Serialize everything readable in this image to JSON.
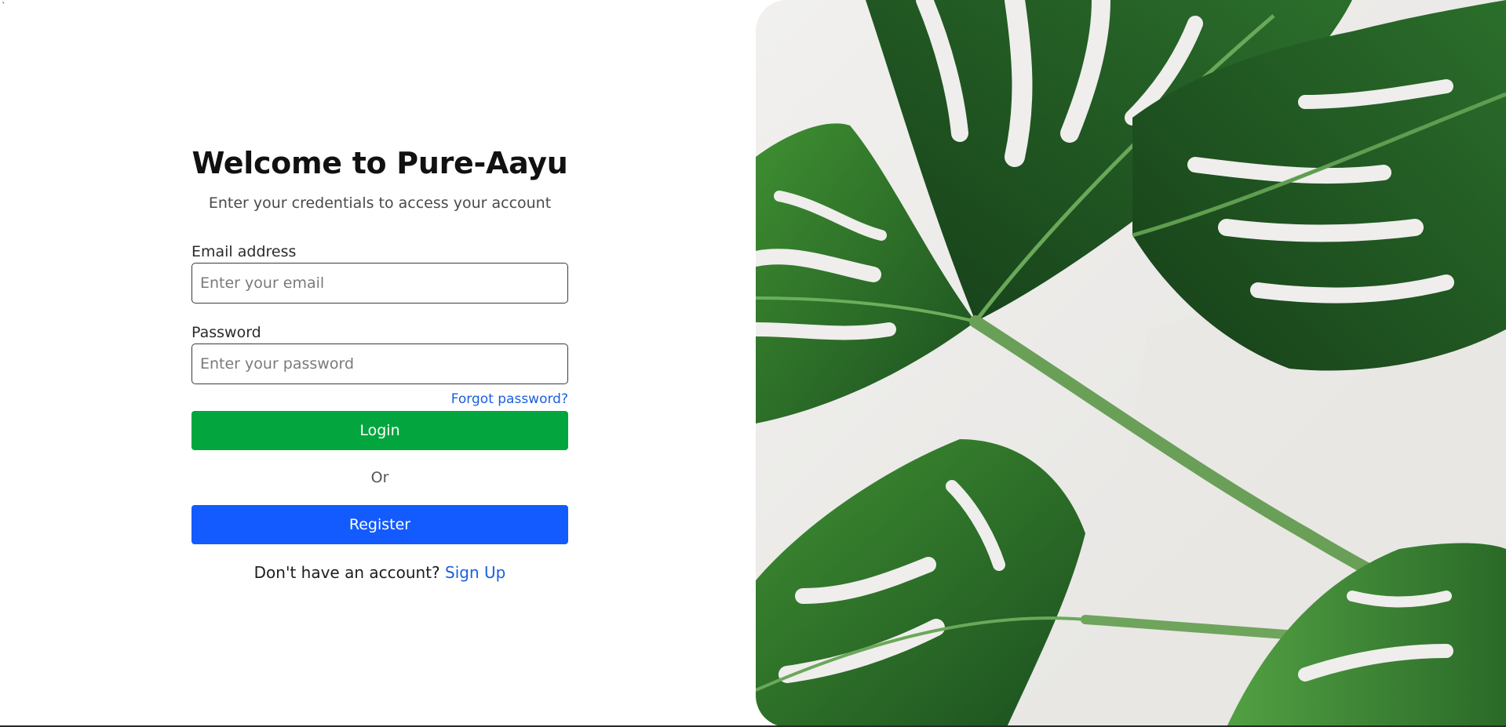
{
  "stray_mark": "`",
  "login": {
    "title": "Welcome to Pure-Aayu",
    "subtitle": "Enter your credentials to access your account",
    "email_label": "Email address",
    "email_placeholder": "Enter your email",
    "email_value": "",
    "password_label": "Password",
    "password_placeholder": "Enter your password",
    "password_value": "",
    "forgot_password": "Forgot password?",
    "login_button": "Login",
    "or_text": "Or",
    "register_button": "Register",
    "no_account_text": "Don't have an account?",
    "signup_link": "Sign Up"
  },
  "hero_image": {
    "subject": "monstera-leaves-photo"
  },
  "colors": {
    "login_button": "#03a63e",
    "register_button": "#135bff",
    "link": "#1a5fe0",
    "image_background": "#efeeec",
    "leaf_dark": "#1f5a24",
    "leaf_mid": "#2f7a2f",
    "leaf_light": "#4a9a3c"
  }
}
